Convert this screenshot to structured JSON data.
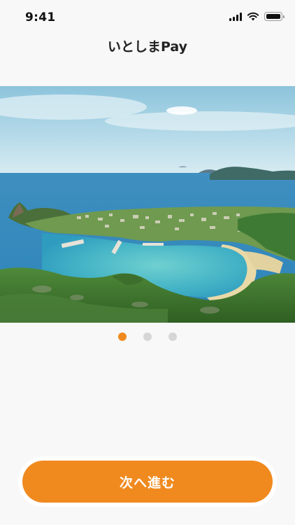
{
  "status_bar": {
    "time": "9:41",
    "icons": [
      "signal-icon",
      "wifi-icon",
      "battery-icon"
    ]
  },
  "header": {
    "title": "いとしまPay"
  },
  "carousel": {
    "image_name": "coastal-bay-photo",
    "page_count": 3,
    "active_page": 1,
    "colors": {
      "active_dot": "#f08a1f",
      "inactive_dot": "#d6d6d6"
    }
  },
  "footer": {
    "next_button_label": "次へ進む",
    "button_color": "#f08a1f"
  }
}
